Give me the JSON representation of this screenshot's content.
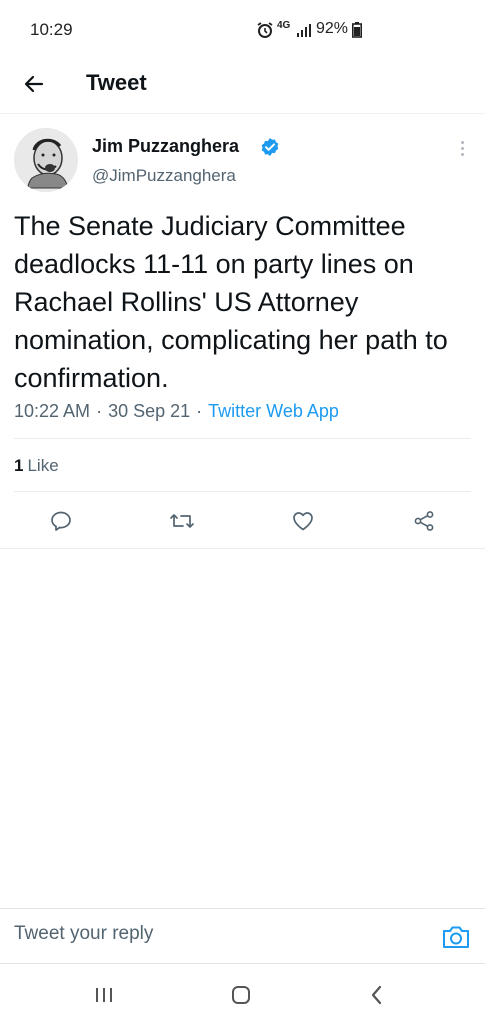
{
  "status_bar": {
    "time": "10:29",
    "network": "4G",
    "battery": "92%"
  },
  "header": {
    "title": "Tweet",
    "back_icon": "arrow-left-icon"
  },
  "tweet": {
    "author_name": "Jim Puzzanghera",
    "author_handle": "@JimPuzzanghera",
    "verified": true,
    "text": "The Senate Judiciary Committee deadlocks 11-11 on party lines on Rachael Rollins' US Attorney nomination, complicating her path to confirmation.",
    "time": "10:22 AM",
    "separator": "·",
    "date": "30 Sep 21",
    "source": "Twitter Web App",
    "like_count": "1",
    "like_label": "Like"
  },
  "actions": [
    "reply-icon",
    "retweet-icon",
    "like-icon",
    "share-icon"
  ],
  "reply": {
    "placeholder": "Tweet your reply"
  },
  "colors": {
    "accent": "#1d9bf0",
    "text": "#0f1419",
    "secondary": "#536471"
  }
}
